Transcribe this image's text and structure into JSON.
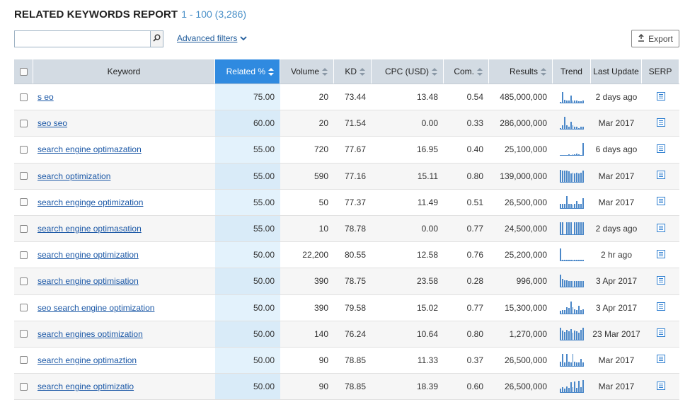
{
  "header": {
    "title": "RELATED KEYWORDS REPORT",
    "range": "1 - 100 (3,286)"
  },
  "search": {
    "placeholder": "",
    "value": ""
  },
  "toolbar": {
    "advanced_filters_label": "Advanced filters",
    "export_label": "Export"
  },
  "colors": {
    "accent": "#2f8ae0",
    "link": "#1a57a6",
    "header_bg": "#d3dbe3",
    "trend": "#4a87c8"
  },
  "columns": {
    "keyword": "Keyword",
    "related": "Related %",
    "volume": "Volume",
    "kd": "KD",
    "cpc": "CPC (USD)",
    "com": "Com.",
    "results": "Results",
    "trend": "Trend",
    "last_update": "Last Update",
    "serp": "SERP"
  },
  "rows": [
    {
      "keyword": "s eo",
      "related": "75.00",
      "volume": "20",
      "kd": "73.44",
      "cpc": "13.48",
      "com": "0.54",
      "results": "485,000,000",
      "last_update": "2 days ago",
      "trend": [
        0.05,
        0.9,
        0.25,
        0.2,
        0.2,
        0.6,
        0.2,
        0.2,
        0.2,
        0.1,
        0.1,
        0.2
      ]
    },
    {
      "keyword": "seo seo",
      "related": "60.00",
      "volume": "20",
      "kd": "71.54",
      "cpc": "0.00",
      "com": "0.33",
      "results": "286,000,000",
      "last_update": "Mar 2017",
      "trend": [
        0.05,
        0.3,
        1.0,
        0.3,
        0.2,
        0.6,
        0.3,
        0.2,
        0.2,
        0.1,
        0.2,
        0.2
      ]
    },
    {
      "keyword": "search engine optimazation",
      "related": "55.00",
      "volume": "720",
      "kd": "77.67",
      "cpc": "16.95",
      "com": "0.40",
      "results": "25,100,000",
      "last_update": "6 days ago",
      "trend": [
        0.05,
        0.05,
        0.05,
        0.05,
        0.1,
        0.05,
        0.1,
        0.1,
        0.15,
        0.1,
        0.05,
        1.0
      ]
    },
    {
      "keyword": "search optimization",
      "related": "55.00",
      "volume": "590",
      "kd": "77.16",
      "cpc": "15.11",
      "com": "0.80",
      "results": "139,000,000",
      "last_update": "Mar 2017",
      "trend": [
        1.0,
        0.95,
        0.9,
        0.9,
        0.85,
        0.7,
        0.75,
        0.7,
        0.75,
        0.7,
        0.75,
        0.9
      ]
    },
    {
      "keyword": "search enginge optimization",
      "related": "55.00",
      "volume": "50",
      "kd": "77.37",
      "cpc": "11.49",
      "com": "0.51",
      "results": "26,500,000",
      "last_update": "Mar 2017",
      "trend": [
        0.35,
        0.35,
        0.35,
        1.0,
        0.35,
        0.35,
        0.3,
        0.35,
        0.6,
        0.35,
        0.35,
        0.8
      ]
    },
    {
      "keyword": "search engine optimasation",
      "related": "55.00",
      "volume": "10",
      "kd": "78.78",
      "cpc": "0.00",
      "com": "0.77",
      "results": "24,500,000",
      "last_update": "2 days ago",
      "trend": [
        1.0,
        1.0,
        0.0,
        1.0,
        1.0,
        1.0,
        0.0,
        1.0,
        1.0,
        1.0,
        1.0,
        1.0
      ]
    },
    {
      "keyword": "search engine optimization",
      "related": "50.00",
      "volume": "22,200",
      "kd": "80.55",
      "cpc": "12.58",
      "com": "0.76",
      "results": "25,200,000",
      "last_update": "2 hr ago",
      "trend": [
        1.0,
        0.1,
        0.1,
        0.1,
        0.1,
        0.1,
        0.1,
        0.1,
        0.1,
        0.1,
        0.1,
        0.1
      ]
    },
    {
      "keyword": "search engine optimisation",
      "related": "50.00",
      "volume": "390",
      "kd": "78.75",
      "cpc": "23.58",
      "com": "0.28",
      "results": "996,000",
      "last_update": "3 Apr 2017",
      "trend": [
        1.0,
        0.7,
        0.55,
        0.55,
        0.5,
        0.5,
        0.5,
        0.5,
        0.5,
        0.5,
        0.5,
        0.5
      ]
    },
    {
      "keyword": "seo search engine optimization",
      "related": "50.00",
      "volume": "390",
      "kd": "79.58",
      "cpc": "15.02",
      "com": "0.77",
      "results": "15,300,000",
      "last_update": "3 Apr 2017",
      "trend": [
        0.2,
        0.25,
        0.3,
        0.5,
        0.45,
        1.0,
        0.5,
        0.35,
        0.3,
        0.6,
        0.3,
        0.35
      ]
    },
    {
      "keyword": "search engines optimization",
      "related": "50.00",
      "volume": "140",
      "kd": "76.24",
      "cpc": "10.64",
      "com": "0.80",
      "results": "1,270,000",
      "last_update": "23 Mar 2017",
      "trend": [
        1.0,
        0.75,
        0.65,
        0.8,
        0.7,
        0.85,
        0.6,
        0.75,
        0.7,
        0.6,
        0.8,
        1.0
      ]
    },
    {
      "keyword": "search engine optimaztion",
      "related": "50.00",
      "volume": "90",
      "kd": "78.85",
      "cpc": "11.33",
      "com": "0.37",
      "results": "26,500,000",
      "last_update": "Mar 2017",
      "trend": [
        0.35,
        1.0,
        0.3,
        1.0,
        0.35,
        0.3,
        1.0,
        0.35,
        0.3,
        0.3,
        0.6,
        0.3
      ]
    },
    {
      "keyword": "search engine optimizatio",
      "related": "50.00",
      "volume": "90",
      "kd": "78.85",
      "cpc": "18.39",
      "com": "0.60",
      "results": "26,500,000",
      "last_update": "Mar 2017",
      "trend": [
        0.3,
        0.4,
        0.3,
        0.5,
        0.35,
        0.85,
        0.4,
        0.9,
        0.35,
        0.95,
        0.4,
        1.0
      ]
    }
  ]
}
